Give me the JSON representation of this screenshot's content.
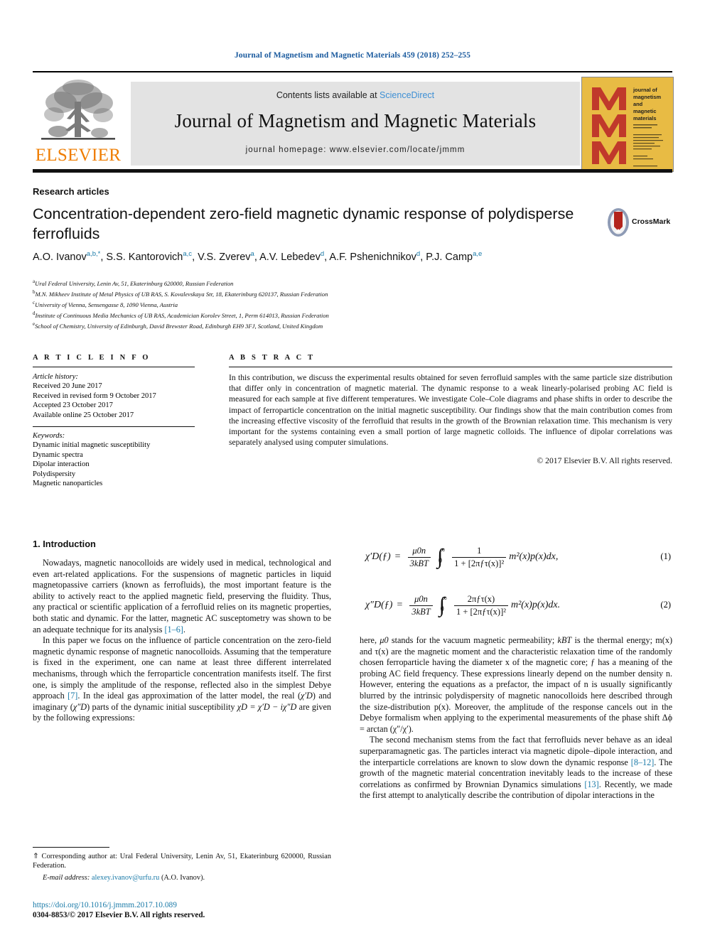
{
  "running_head": "Journal of Magnetism and Magnetic Materials 459 (2018) 252–255",
  "masthead": {
    "publisher_name": "ELSEVIER",
    "contents_prefix": "Contents lists available at ",
    "contents_link": "ScienceDirect",
    "journal_title": "Journal of Magnetism and Magnetic Materials",
    "homepage": "journal homepage: www.elsevier.com/locate/jmmm",
    "cover_lines": [
      "journal of",
      "magnetism",
      "and",
      "magnetic",
      "materials"
    ],
    "cover_letter": "M",
    "cover_bg": "#e8bb44",
    "cover_letter_color": "#c0392b"
  },
  "article": {
    "kicker": "Research articles",
    "title": "Concentration-dependent zero-field magnetic dynamic response of polydisperse ferrofluids",
    "crossmark_label": "CrossMark",
    "authors": [
      {
        "name": "A.O. Ivanov",
        "marks": "a,b,*"
      },
      {
        "name": "S.S. Kantorovich",
        "marks": "a,c"
      },
      {
        "name": "V.S. Zverev",
        "marks": "a"
      },
      {
        "name": "A.V. Lebedev",
        "marks": "d"
      },
      {
        "name": "A.F. Pshenichnikov",
        "marks": "d"
      },
      {
        "name": "P.J. Camp",
        "marks": "a,e"
      }
    ],
    "affiliations": [
      {
        "mark": "a",
        "text": "Ural Federal University, Lenin Av, 51, Ekaterinburg 620000, Russian Federation"
      },
      {
        "mark": "b",
        "text": "M.N. Mikheev Institute of Metal Physics of UB RAS, S. Kovalevskaya Str, 18, Ekaterinburg 620137, Russian Federation"
      },
      {
        "mark": "c",
        "text": "University of Vienna, Sensengasse 8, 1090 Vienna, Austria"
      },
      {
        "mark": "d",
        "text": "Institute of Continuous Media Mechanics of UB RAS, Academician Korolev Street, 1, Perm 614013, Russian Federation"
      },
      {
        "mark": "e",
        "text": "School of Chemistry, University of Edinburgh, David Brewster Road, Edinburgh EH9 3FJ, Scotland, United Kingdom"
      }
    ]
  },
  "info": {
    "heading": "A R T I C L E    I N F O",
    "history_label": "Article history:",
    "history": [
      "Received 20 June 2017",
      "Received in revised form 9 October 2017",
      "Accepted 23 October 2017",
      "Available online 25 October 2017"
    ],
    "keywords_label": "Keywords:",
    "keywords": [
      "Dynamic initial magnetic susceptibility",
      "Dynamic spectra",
      "Dipolar interaction",
      "Polydispersity",
      "Magnetic nanoparticles"
    ]
  },
  "abstract": {
    "heading": "A B S T R A C T",
    "text": "In this contribution, we discuss the experimental results obtained for seven ferrofluid samples with the same particle size distribution that differ only in concentration of magnetic material. The dynamic response to a weak linearly-polarised probing AC field is measured for each sample at five different temperatures. We investigate Cole–Cole diagrams and phase shifts in order to describe the impact of ferroparticle concentration on the initial magnetic susceptibility. Our findings show that the main contribution comes from the increasing effective viscosity of the ferrofluid that results in the growth of the Brownian relaxation time. This mechanism is very important for the systems containing even a small portion of large magnetic colloids. The influence of dipolar correlations was separately analysed using computer simulations.",
    "copyright": "© 2017 Elsevier B.V. All rights reserved."
  },
  "body": {
    "section_title": "1. Introduction",
    "left_paragraphs": [
      {
        "pre": "Nowadays, magnetic nanocolloids are widely used in medical, technological and even art-related applications. For the suspensions of magnetic particles in liquid magnetopassive carriers (known as ferrofluids), the most important feature is the ability to actively react to the applied magnetic field, preserving the fluidity. Thus, any practical or scientific application of a ferrofluid relies on its magnetic properties, both static and dynamic. For the latter, magnetic AC susceptometry was shown to be an adequate technique for its analysis ",
        "ref": "[1–6]",
        "post": "."
      }
    ],
    "left_par2_a": "In this paper we focus on the influence of particle concentration on the zero-field magnetic dynamic response of magnetic nanocolloids. Assuming that the temperature is fixed in the experiment, one can name at least three different interrelated mechanisms, through which the ferroparticle concentration manifests itself. The first one, is simply the amplitude of the response, reflected also in the simplest Debye approach ",
    "left_par2_ref": "[7]",
    "left_par2_b": ". In the ideal gas approximation of the latter model, the real (",
    "left_par2_sym1": "χ′D",
    "left_par2_c": ") and imaginary (",
    "left_par2_sym2": "χ″D",
    "left_par2_d": ") parts of the dynamic initial susceptibility ",
    "left_par2_sym3": "χD = χ′D − iχ″D",
    "left_par2_e": " are given by the following expressions:",
    "right_par1_a": "here, ",
    "right_par1_sym": "μ0",
    "right_par1_b": " stands for the vacuum magnetic permeability; ",
    "right_par1_sym2": "kBT",
    "right_par1_c": " is the thermal energy; m(x) and τ(x) are the magnetic moment and the characteristic relaxation time of the randomly chosen ferroparticle having the diameter x of the magnetic core; ƒ has a meaning of the probing AC field frequency. These expressions linearly depend on the number density n. However, entering the equations as a prefactor, the impact of n is usually significantly blurred by the intrinsic polydispersity of magnetic nanocolloids here described through the size-distribution p(x). Moreover, the amplitude of the response cancels out in the Debye formalism when applying to the experimental measurements of the phase shift Δϕ = arctan (χ″/χ′).",
    "right_par2_a": "The second mechanism stems from the fact that ferrofluids never behave as an ideal superparamagnetic gas. The particles interact via magnetic dipole–dipole interaction, and the interparticle correlations are known to slow down the dynamic response ",
    "right_par2_ref1": "[8–12]",
    "right_par2_b": ". The growth of the magnetic material concentration inevitably leads to the increase of these correlations as confirmed by Brownian Dynamics simulations ",
    "right_par2_ref2": "[13]",
    "right_par2_c": ". Recently, we made the first attempt to analytically describe the contribution of dipolar interactions in the"
  },
  "equations": [
    {
      "lhs": "χ′D(ƒ)",
      "prefactor_num": "μ0n",
      "prefactor_den": "3kBT",
      "integral_upper": "∞",
      "integral_lower": "0",
      "frac_num": "1",
      "frac_den": "1 + [2πƒτ(x)]²",
      "tail": "m²(x)p(x)dx,",
      "number": "(1)"
    },
    {
      "lhs": "χ″D(ƒ)",
      "prefactor_num": "μ0n",
      "prefactor_den": "3kBT",
      "integral_upper": "∞",
      "integral_lower": "0",
      "frac_num": "2πƒτ(x)",
      "frac_den": "1 + [2πƒτ(x)]²",
      "tail": "m²(x)p(x)dx.",
      "number": "(2)"
    }
  ],
  "footnote": {
    "corresponding": "⇑ Corresponding author at: Ural Federal University, Lenin Av, 51, Ekaterinburg 620000, Russian Federation.",
    "email_label": "E-mail address:",
    "email": "alexey.ivanov@urfu.ru",
    "email_owner": "(A.O. Ivanov).",
    "doi": "https://doi.org/10.1016/j.jmmm.2017.10.089",
    "issn": "0304-8853/© 2017 Elsevier B.V. All rights reserved."
  },
  "colors": {
    "link": "#1a7aa8",
    "running_head": "#1a5a9e",
    "elsevier_orange": "#ef7d00",
    "band_gray": "#e3e3e3"
  }
}
